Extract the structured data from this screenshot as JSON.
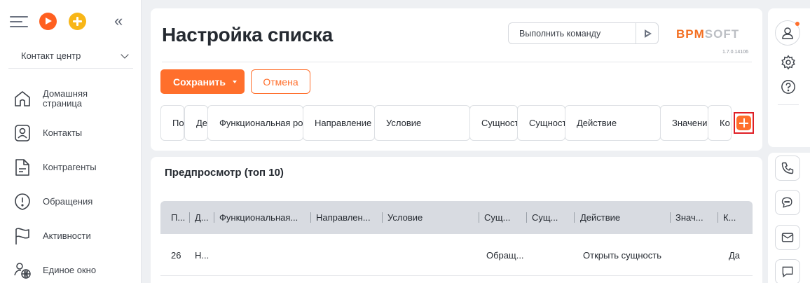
{
  "sidebar": {
    "workspace": "Контакт центр",
    "items": [
      {
        "label": "Домашняя страница",
        "icon": "home-icon"
      },
      {
        "label": "Контакты",
        "icon": "contact-icon"
      },
      {
        "label": "Контрагенты",
        "icon": "document-icon"
      },
      {
        "label": "Обращения",
        "icon": "alert-icon"
      },
      {
        "label": "Активности",
        "icon": "flag-icon"
      },
      {
        "label": "Единое окно",
        "icon": "omnichannel-icon"
      }
    ]
  },
  "header": {
    "title": "Настройка списка",
    "command_placeholder": "Выполнить команду",
    "logo_part1": "BPM",
    "logo_part2": "SOFT",
    "version": "1.7.0.14106"
  },
  "toolbar": {
    "save_label": "Сохранить",
    "cancel_label": "Отмена"
  },
  "columns": [
    "По",
    "Де",
    "Функциональная ро",
    "Направление",
    "Условие",
    "Сущност",
    "Сущност",
    "Действие",
    "Значени",
    "Ко"
  ],
  "preview": {
    "title": "Предпросмотр (топ 10)",
    "headers": [
      "П...",
      "Д...",
      "Функциональная...",
      "Направлен...",
      "Условие",
      "Сущ...",
      "Сущ...",
      "Действие",
      "Знач...",
      "К..."
    ],
    "rows": [
      {
        "cells": [
          "26",
          "Н...",
          "",
          "",
          "",
          "Обращ...",
          "",
          "Открыть сущность",
          "",
          "Да"
        ]
      }
    ]
  },
  "colors": {
    "accent": "#ff6f2c",
    "highlight_border": "#e01f26"
  }
}
